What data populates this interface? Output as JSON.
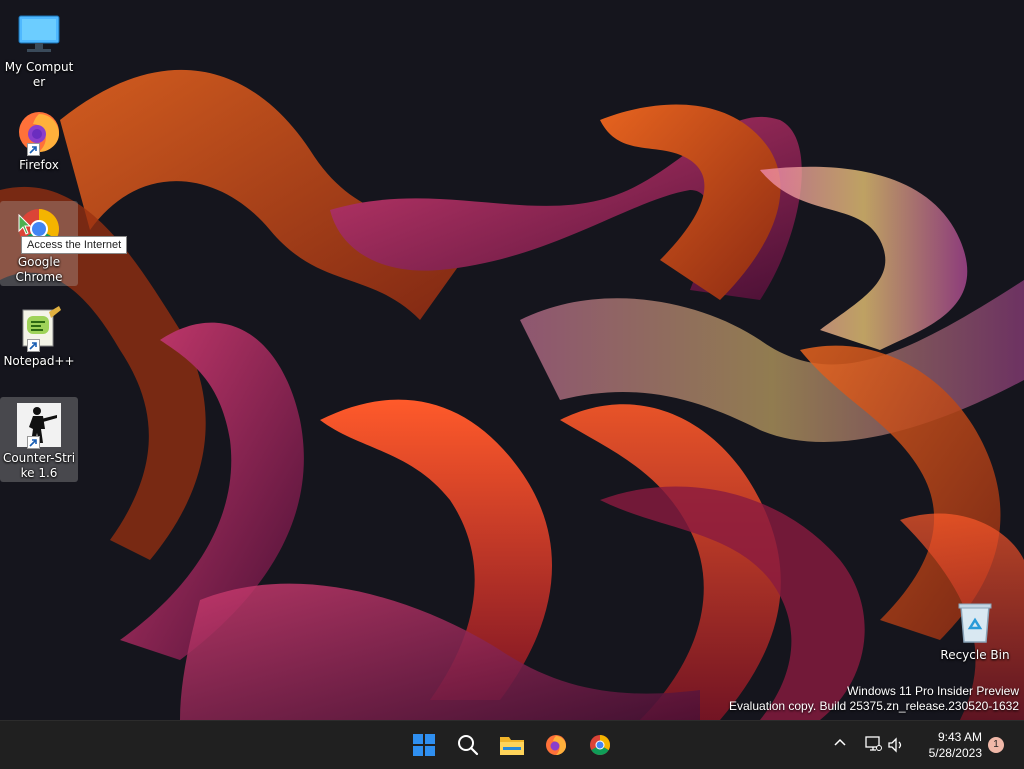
{
  "desktop": {
    "icons": [
      {
        "label": "My Computer"
      },
      {
        "label": "Firefox"
      },
      {
        "label": "Google Chrome"
      },
      {
        "label": "Notepad++"
      },
      {
        "label": "Counter-Strike 1.6"
      }
    ],
    "recycle_bin": {
      "label": "Recycle Bin"
    },
    "tooltip": "Access the Internet",
    "watermark": {
      "line1": "Windows 11 Pro Insider Preview",
      "line2": "Evaluation copy. Build 25375.zn_release.230520-1632"
    }
  },
  "taskbar": {
    "pinned": [
      "start-icon",
      "search-icon",
      "file-explorer-icon",
      "firefox-icon",
      "chrome-icon"
    ],
    "clock": {
      "time": "9:43 AM",
      "date": "5/28/2023"
    },
    "notifications": "1"
  },
  "colors": {
    "taskbar_bg": "#202020",
    "windows_blue": "#2f8ff0",
    "wallpaper_bg": "#15151d",
    "ribbon_orange": "#d7521c",
    "ribbon_magenta": "#a52a5a"
  }
}
